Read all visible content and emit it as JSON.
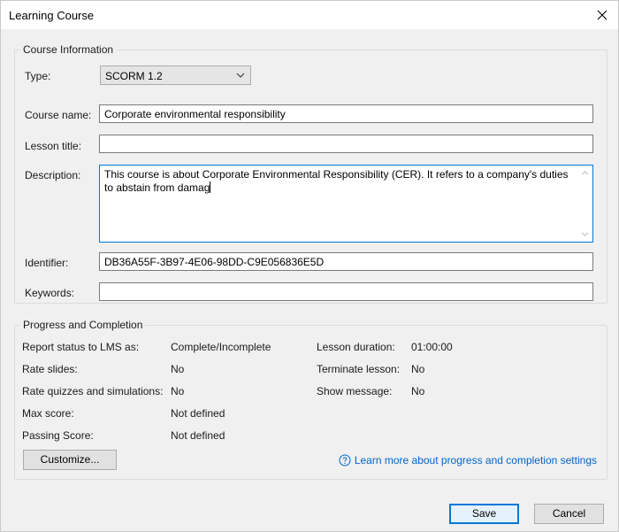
{
  "window": {
    "title": "Learning Course",
    "close_icon": "close-icon"
  },
  "course_info": {
    "legend": "Course Information",
    "type_label": "Type:",
    "type_value": "SCORM 1.2",
    "course_name_label": "Course name:",
    "course_name_value": "Corporate environmental responsibility",
    "lesson_title_label": "Lesson title:",
    "lesson_title_value": "",
    "description_label": "Description:",
    "description_value": "This course is about Corporate Environmental Responsibility (CER). It refers to a company's duties to abstain from damag",
    "identifier_label": "Identifier:",
    "identifier_value": "DB36A55F-3B97-4E06-98DD-C9E056836E5D",
    "keywords_label": "Keywords:",
    "keywords_value": ""
  },
  "progress": {
    "legend": "Progress and Completion",
    "left_rows": [
      {
        "label": "Report status to LMS as:",
        "value": "Complete/Incomplete"
      },
      {
        "label": "Rate slides:",
        "value": "No"
      },
      {
        "label": "Rate quizzes and simulations:",
        "value": "No"
      },
      {
        "label": "Max score:",
        "value": "Not defined"
      },
      {
        "label": "Passing Score:",
        "value": "Not defined"
      }
    ],
    "right_rows": [
      {
        "label": "Lesson duration:",
        "value": "01:00:00"
      },
      {
        "label": "Terminate lesson:",
        "value": "No"
      },
      {
        "label": "Show message:",
        "value": "No"
      }
    ],
    "customize_label": "Customize...",
    "learn_more_label": "Learn more about progress and completion settings",
    "learn_more_icon": "help-circle-icon"
  },
  "footer": {
    "save_label": "Save",
    "cancel_label": "Cancel"
  },
  "colors": {
    "accent": "#0078d7",
    "link": "#0066cc",
    "background": "#f0f0f0"
  }
}
